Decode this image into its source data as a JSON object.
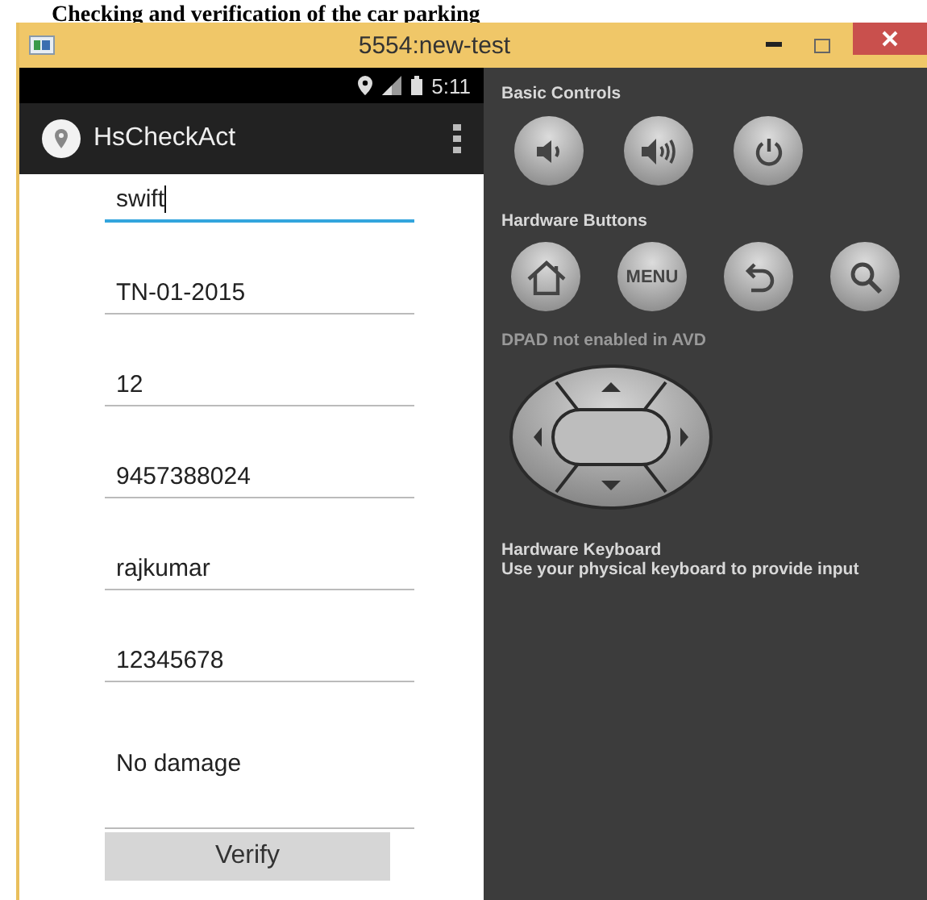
{
  "caption": "Checking and verification of the car parking",
  "window": {
    "title": "5554:new-test"
  },
  "status_bar": {
    "time": "5:11"
  },
  "action_bar": {
    "title": "HsCheckAct"
  },
  "fields": [
    {
      "value": "swift",
      "focused": true,
      "multiline": false
    },
    {
      "value": "TN-01-2015",
      "focused": false,
      "multiline": false
    },
    {
      "value": "12",
      "focused": false,
      "multiline": false
    },
    {
      "value": "9457388024",
      "focused": false,
      "multiline": false
    },
    {
      "value": "rajkumar",
      "focused": false,
      "multiline": false
    },
    {
      "value": "12345678",
      "focused": false,
      "multiline": false
    },
    {
      "value": "No damage",
      "focused": false,
      "multiline": true
    }
  ],
  "verify_button": "Verify",
  "controls": {
    "basic_title": "Basic Controls",
    "basic": [
      {
        "kind": "volume-down"
      },
      {
        "kind": "volume-up"
      },
      {
        "kind": "power"
      }
    ],
    "hardware_title": "Hardware Buttons",
    "hardware": [
      {
        "kind": "home"
      },
      {
        "kind": "menu",
        "label": "MENU"
      },
      {
        "kind": "back"
      },
      {
        "kind": "search"
      }
    ],
    "dpad_note": "**DPAD** not enabled in AVD",
    "keyboard_title": "Hardware Keyboard",
    "keyboard_note": "Use your physical keyboard to provide input"
  }
}
